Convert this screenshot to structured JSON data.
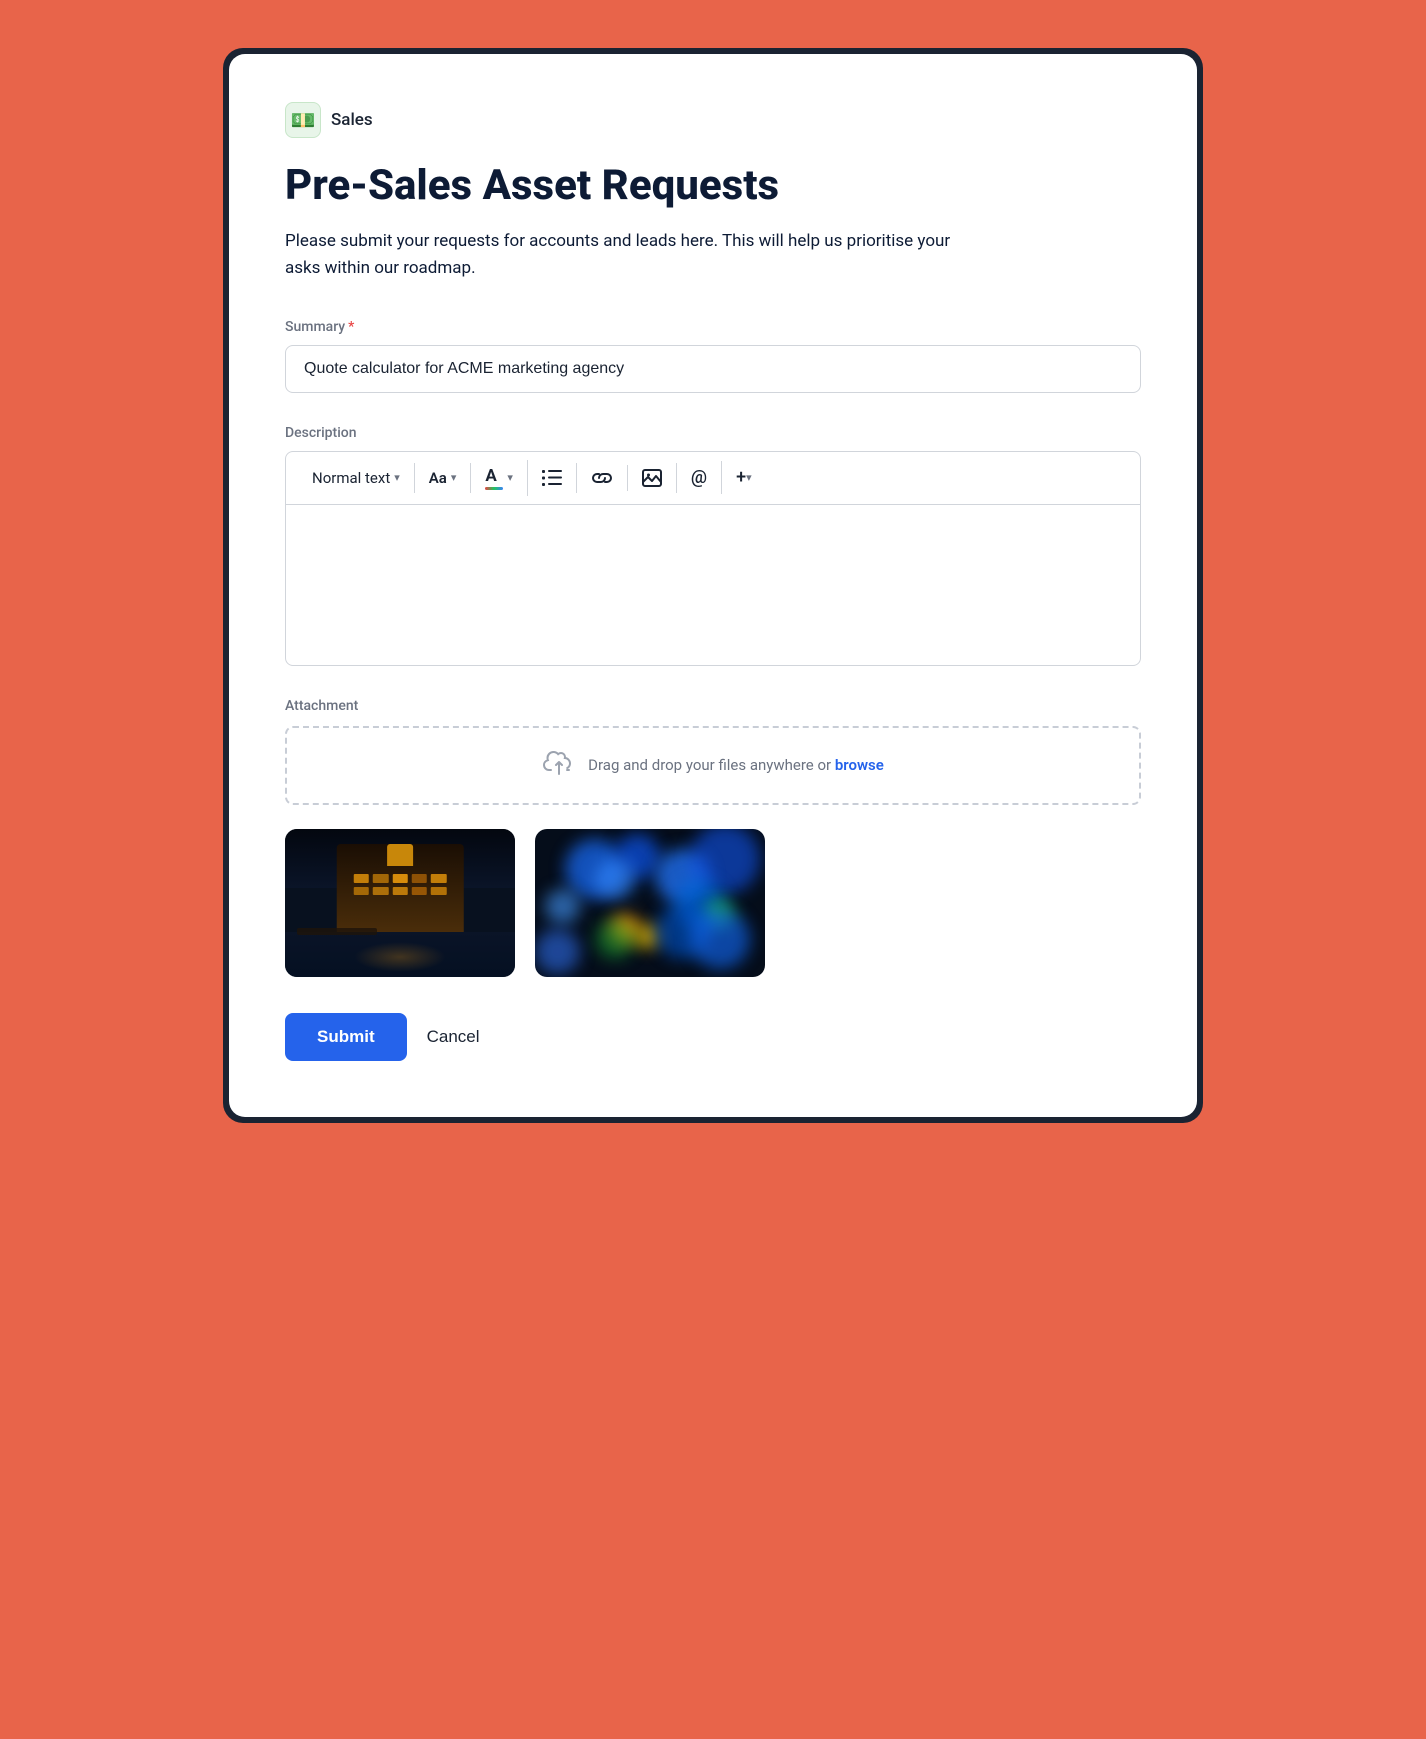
{
  "app": {
    "icon": "💵",
    "name": "Sales"
  },
  "page": {
    "title": "Pre-Sales Asset Requests",
    "description": "Please submit your requests for accounts and leads here. This will help us prioritise your asks within our roadmap."
  },
  "form": {
    "summary": {
      "label": "Summary",
      "required": "*",
      "placeholder": "",
      "value": "Quote calculator for ACME marketing agency"
    },
    "description": {
      "label": "Description",
      "toolbar": {
        "normal_text": "Normal text",
        "font_size": "Aa",
        "color": "A"
      }
    },
    "attachment": {
      "label": "Attachment",
      "dropzone_text": "Drag and drop your files anywhere or ",
      "browse_label": "browse"
    }
  },
  "buttons": {
    "submit": "Submit",
    "cancel": "Cancel"
  }
}
